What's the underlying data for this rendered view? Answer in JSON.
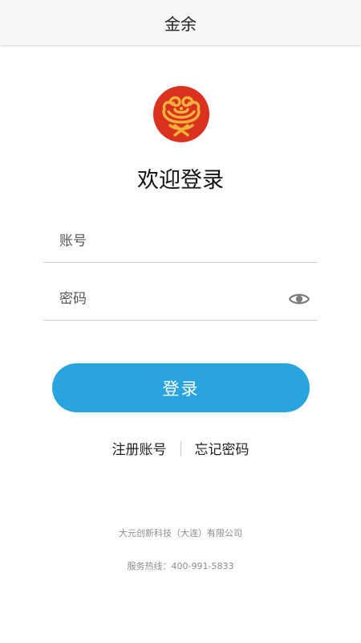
{
  "header": {
    "title": "金余"
  },
  "logo": {
    "icon": "auspicious-cloud-logo-icon",
    "colors": {
      "circle": "#d9321f",
      "emblem": "#f2b33d"
    }
  },
  "welcome": {
    "text": "欢迎登录"
  },
  "form": {
    "account": {
      "value": "",
      "placeholder": "账号"
    },
    "password": {
      "value": "",
      "placeholder": "密码",
      "toggle_icon": "eye-icon"
    }
  },
  "actions": {
    "login_label": "登录",
    "register_label": "注册账号",
    "forgot_label": "忘记密码"
  },
  "footer": {
    "company": "大元创新科技（大连）有限公司",
    "hotline": "服务热线：400-991-5833"
  },
  "colors": {
    "accent": "#29a4de",
    "header_bg": "#f7f7f7",
    "divider": "#cfcfcf"
  }
}
